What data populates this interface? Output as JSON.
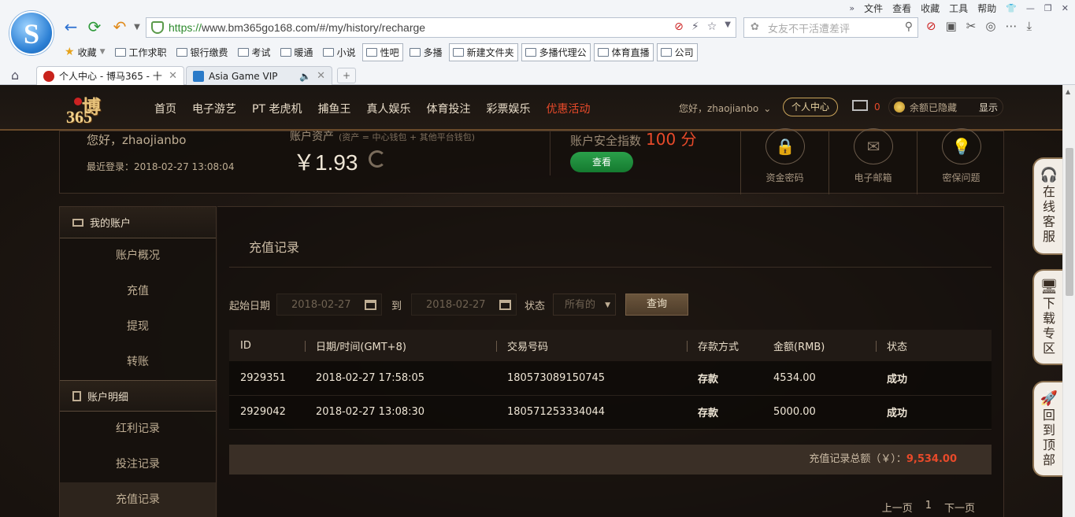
{
  "browser": {
    "menu": [
      "文件",
      "查看",
      "收藏",
      "工具",
      "帮助"
    ],
    "url_proto": "https://",
    "url_rest": "www.bm365go168.com/#/my/history/recharge",
    "search_placeholder": "女友不干活遭差评",
    "bookmarks": [
      "收藏",
      "工作求职",
      "银行缴费",
      "考试",
      "暖通",
      "小说",
      "性吧",
      "多播",
      "新建文件夹",
      "多播代理公",
      "体育直播",
      "公司"
    ],
    "tabs": [
      {
        "label": "个人中心 - 博马365 - 十"
      },
      {
        "label": "Asia Game VIP"
      }
    ]
  },
  "site": {
    "logo_line1": "博",
    "logo_line2": "365",
    "nav": [
      "首页",
      "电子游艺",
      "PT 老虎机",
      "捕鱼王",
      "真人娱乐",
      "体育投注",
      "彩票娱乐",
      "优惠活动"
    ],
    "greeting": "您好，zhaojianbo",
    "personal_center": "个人中心",
    "mail_count": "0",
    "balance_hidden": "余额已隐藏",
    "show": "显示"
  },
  "summary": {
    "hello": "您好，zhaojianbo",
    "last_login": "最近登录：2018-02-27 13:08:04",
    "asset_label": "账户资产",
    "asset_note": "(资产 = 中心钱包 + 其他平台钱包)",
    "asset_value": "￥1.93",
    "safety_label": "账户安全指数",
    "safety_score": "100 分",
    "view_btn": "查看",
    "security": [
      "资金密码",
      "电子邮箱",
      "密保问题"
    ]
  },
  "sidebar": {
    "group1_title": "我的账户",
    "group1_items": [
      "账户概况",
      "充值",
      "提现",
      "转账"
    ],
    "group2_title": "账户明细",
    "group2_items": [
      "红利记录",
      "投注记录",
      "充值记录"
    ]
  },
  "main": {
    "title": "充值记录",
    "start_label": "起始日期",
    "start_date": "2018-02-27",
    "to_label": "到",
    "end_date": "2018-02-27",
    "status_label": "状态",
    "status_value": "所有的",
    "query_btn": "查询",
    "columns": [
      "ID",
      "日期/时间(GMT+8)",
      "交易号码",
      "存款方式",
      "金额(RMB)",
      "状态"
    ],
    "rows": [
      [
        "2929351",
        "2018-02-27 17:58:05",
        "180573089150745",
        "存款",
        "4534.00",
        "成功"
      ],
      [
        "2929042",
        "2018-02-27 13:08:30",
        "180571253334044",
        "存款",
        "5000.00",
        "成功"
      ]
    ],
    "total_label": "充值记录总额（￥）：",
    "total_value": "9,534.00",
    "pager": [
      "上一页",
      "1",
      "下一页"
    ]
  },
  "floats": [
    "在线客服",
    "下载专区",
    "回到顶部"
  ]
}
